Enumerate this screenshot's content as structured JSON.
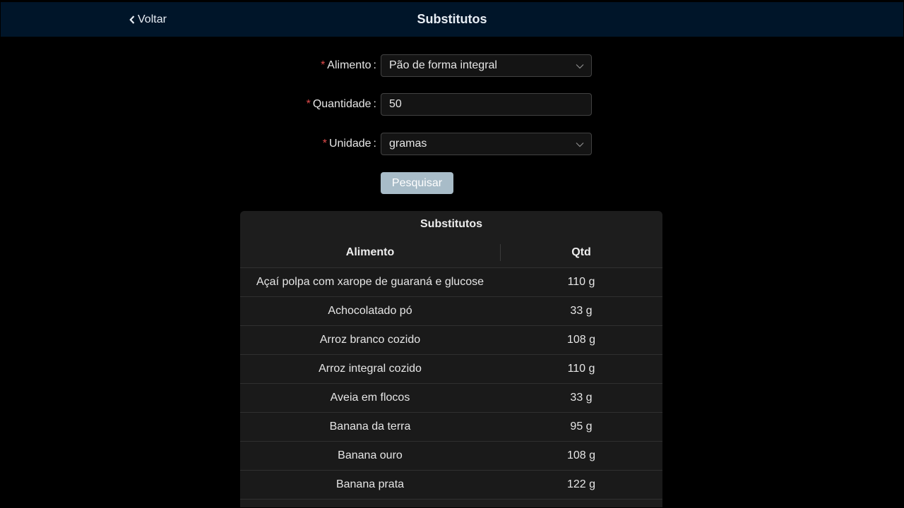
{
  "header": {
    "back_label": "Voltar",
    "title": "Substitutos"
  },
  "form": {
    "alimento": {
      "label": "Alimento",
      "value": "Pão de forma integral"
    },
    "quantidade": {
      "label": "Quantidade",
      "value": "50"
    },
    "unidade": {
      "label": "Unidade",
      "value": "gramas"
    },
    "required_mark": "*",
    "search_label": "Pesquisar"
  },
  "table": {
    "title": "Substitutos",
    "columns": [
      "Alimento",
      "Qtd"
    ],
    "rows": [
      [
        "Açaí polpa com xarope de guaraná e glucose",
        "110 g"
      ],
      [
        "Achocolatado pó",
        "33 g"
      ],
      [
        "Arroz branco cozido",
        "108 g"
      ],
      [
        "Arroz integral cozido",
        "110 g"
      ],
      [
        "Aveia em flocos",
        "33 g"
      ],
      [
        "Banana da terra",
        "95 g"
      ],
      [
        "Banana ouro",
        "108 g"
      ],
      [
        "Banana prata",
        "122 g"
      ]
    ]
  },
  "colors": {
    "header_bg": "#001529",
    "required": "#e04b4b",
    "button_bg": "#a8bcc8"
  },
  "icons": [
    "chevron-left-icon",
    "chevron-down-icon"
  ]
}
